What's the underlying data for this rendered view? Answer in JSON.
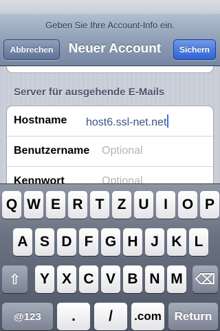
{
  "header": {
    "prompt": "Geben Sie Ihre Account-Info ein.",
    "title": "Neuer Account",
    "cancel_label": "Abbrechen",
    "save_label": "Sichern"
  },
  "section": {
    "title": "Server für ausgehende E-Mails",
    "rows": [
      {
        "label": "Hostname",
        "value": "host6.ssl-net.net",
        "placeholder": ""
      },
      {
        "label": "Benutzername",
        "value": "",
        "placeholder": "Optional"
      },
      {
        "label": "Kennwort",
        "value": "",
        "placeholder": "Optional"
      }
    ]
  },
  "keyboard": {
    "row1": [
      "Q",
      "W",
      "E",
      "R",
      "T",
      "Z",
      "U",
      "I",
      "O",
      "P"
    ],
    "row2": [
      "A",
      "S",
      "D",
      "F",
      "G",
      "H",
      "J",
      "K",
      "L"
    ],
    "row3": [
      "Y",
      "X",
      "C",
      "V",
      "B",
      "N",
      "M"
    ],
    "shift_icon": "shift-arrow-icon",
    "backspace_icon": "backspace-icon",
    "shift_glyph": "⇧",
    "backspace_glyph": "⌫",
    "numbers_label": "@123",
    "dot_label": ".",
    "slash_label": "/",
    "dotcom_label": ".com",
    "return_label": "Return"
  },
  "colors": {
    "value_text": "#395185",
    "save_button": "#2d62d8",
    "cursor": "#3a6fe8"
  }
}
